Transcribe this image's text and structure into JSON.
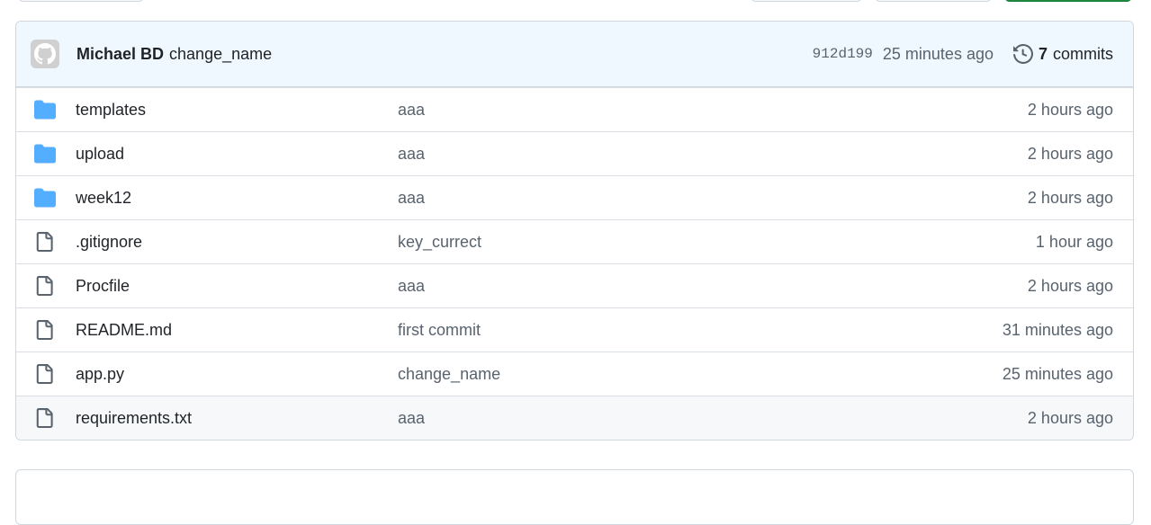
{
  "latest_commit": {
    "author": "Michael BD",
    "message": "change_name",
    "sha": "912d199",
    "time": "25 minutes ago",
    "commit_count": "7",
    "commits_label": "commits"
  },
  "files": [
    {
      "type": "folder",
      "name": "templates",
      "message": "aaa",
      "time": "2 hours ago"
    },
    {
      "type": "folder",
      "name": "upload",
      "message": "aaa",
      "time": "2 hours ago"
    },
    {
      "type": "folder",
      "name": "week12",
      "message": "aaa",
      "time": "2 hours ago"
    },
    {
      "type": "file",
      "name": ".gitignore",
      "message": "key_currect",
      "time": "1 hour ago"
    },
    {
      "type": "file",
      "name": "Procfile",
      "message": "aaa",
      "time": "2 hours ago"
    },
    {
      "type": "file",
      "name": "README.md",
      "message": "first commit",
      "time": "31 minutes ago"
    },
    {
      "type": "file",
      "name": "app.py",
      "message": "change_name",
      "time": "25 minutes ago"
    },
    {
      "type": "file",
      "name": "requirements.txt",
      "message": "aaa",
      "time": "2 hours ago"
    }
  ],
  "colors": {
    "folder_icon": "#54aeff",
    "file_icon": "#59636e",
    "header_bg": "#f0f8ff",
    "hover_row_bg": "#f6f8fa",
    "primary_button": "#1f883d"
  }
}
